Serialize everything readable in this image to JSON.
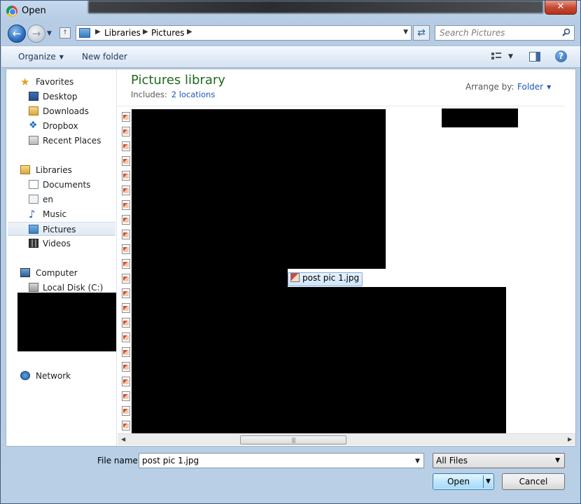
{
  "window": {
    "title": "Open",
    "close_label": "✕"
  },
  "address": {
    "crumbs": [
      "Libraries",
      "Pictures"
    ]
  },
  "search": {
    "placeholder": "Search Pictures"
  },
  "toolbar": {
    "organize": "Organize",
    "new_folder": "New folder",
    "help": "?"
  },
  "nav": {
    "favorites": {
      "header": "Favorites",
      "items": [
        "Desktop",
        "Downloads",
        "Dropbox",
        "Recent Places"
      ]
    },
    "libraries": {
      "header": "Libraries",
      "items": [
        "Documents",
        "en",
        "Music",
        "Pictures",
        "Videos"
      ],
      "selected": "Pictures"
    },
    "computer": {
      "header": "Computer",
      "items": [
        "Local Disk (C:)"
      ]
    },
    "network": {
      "header": "Network"
    }
  },
  "library": {
    "title": "Pictures library",
    "includes_label": "Includes:",
    "locations_link": "2 locations",
    "arrange_label": "Arrange by:",
    "arrange_value": "Folder"
  },
  "files": {
    "selected_name": "post pic 1.jpg"
  },
  "bottom": {
    "file_name_label": "File name:",
    "file_name_value": "post pic 1.jpg",
    "file_type": "All Files",
    "open": "Open",
    "cancel": "Cancel"
  },
  "colors": {
    "library_title": "#1e6a1e",
    "link": "#1a58b8",
    "selection": "#cfe4fa"
  }
}
